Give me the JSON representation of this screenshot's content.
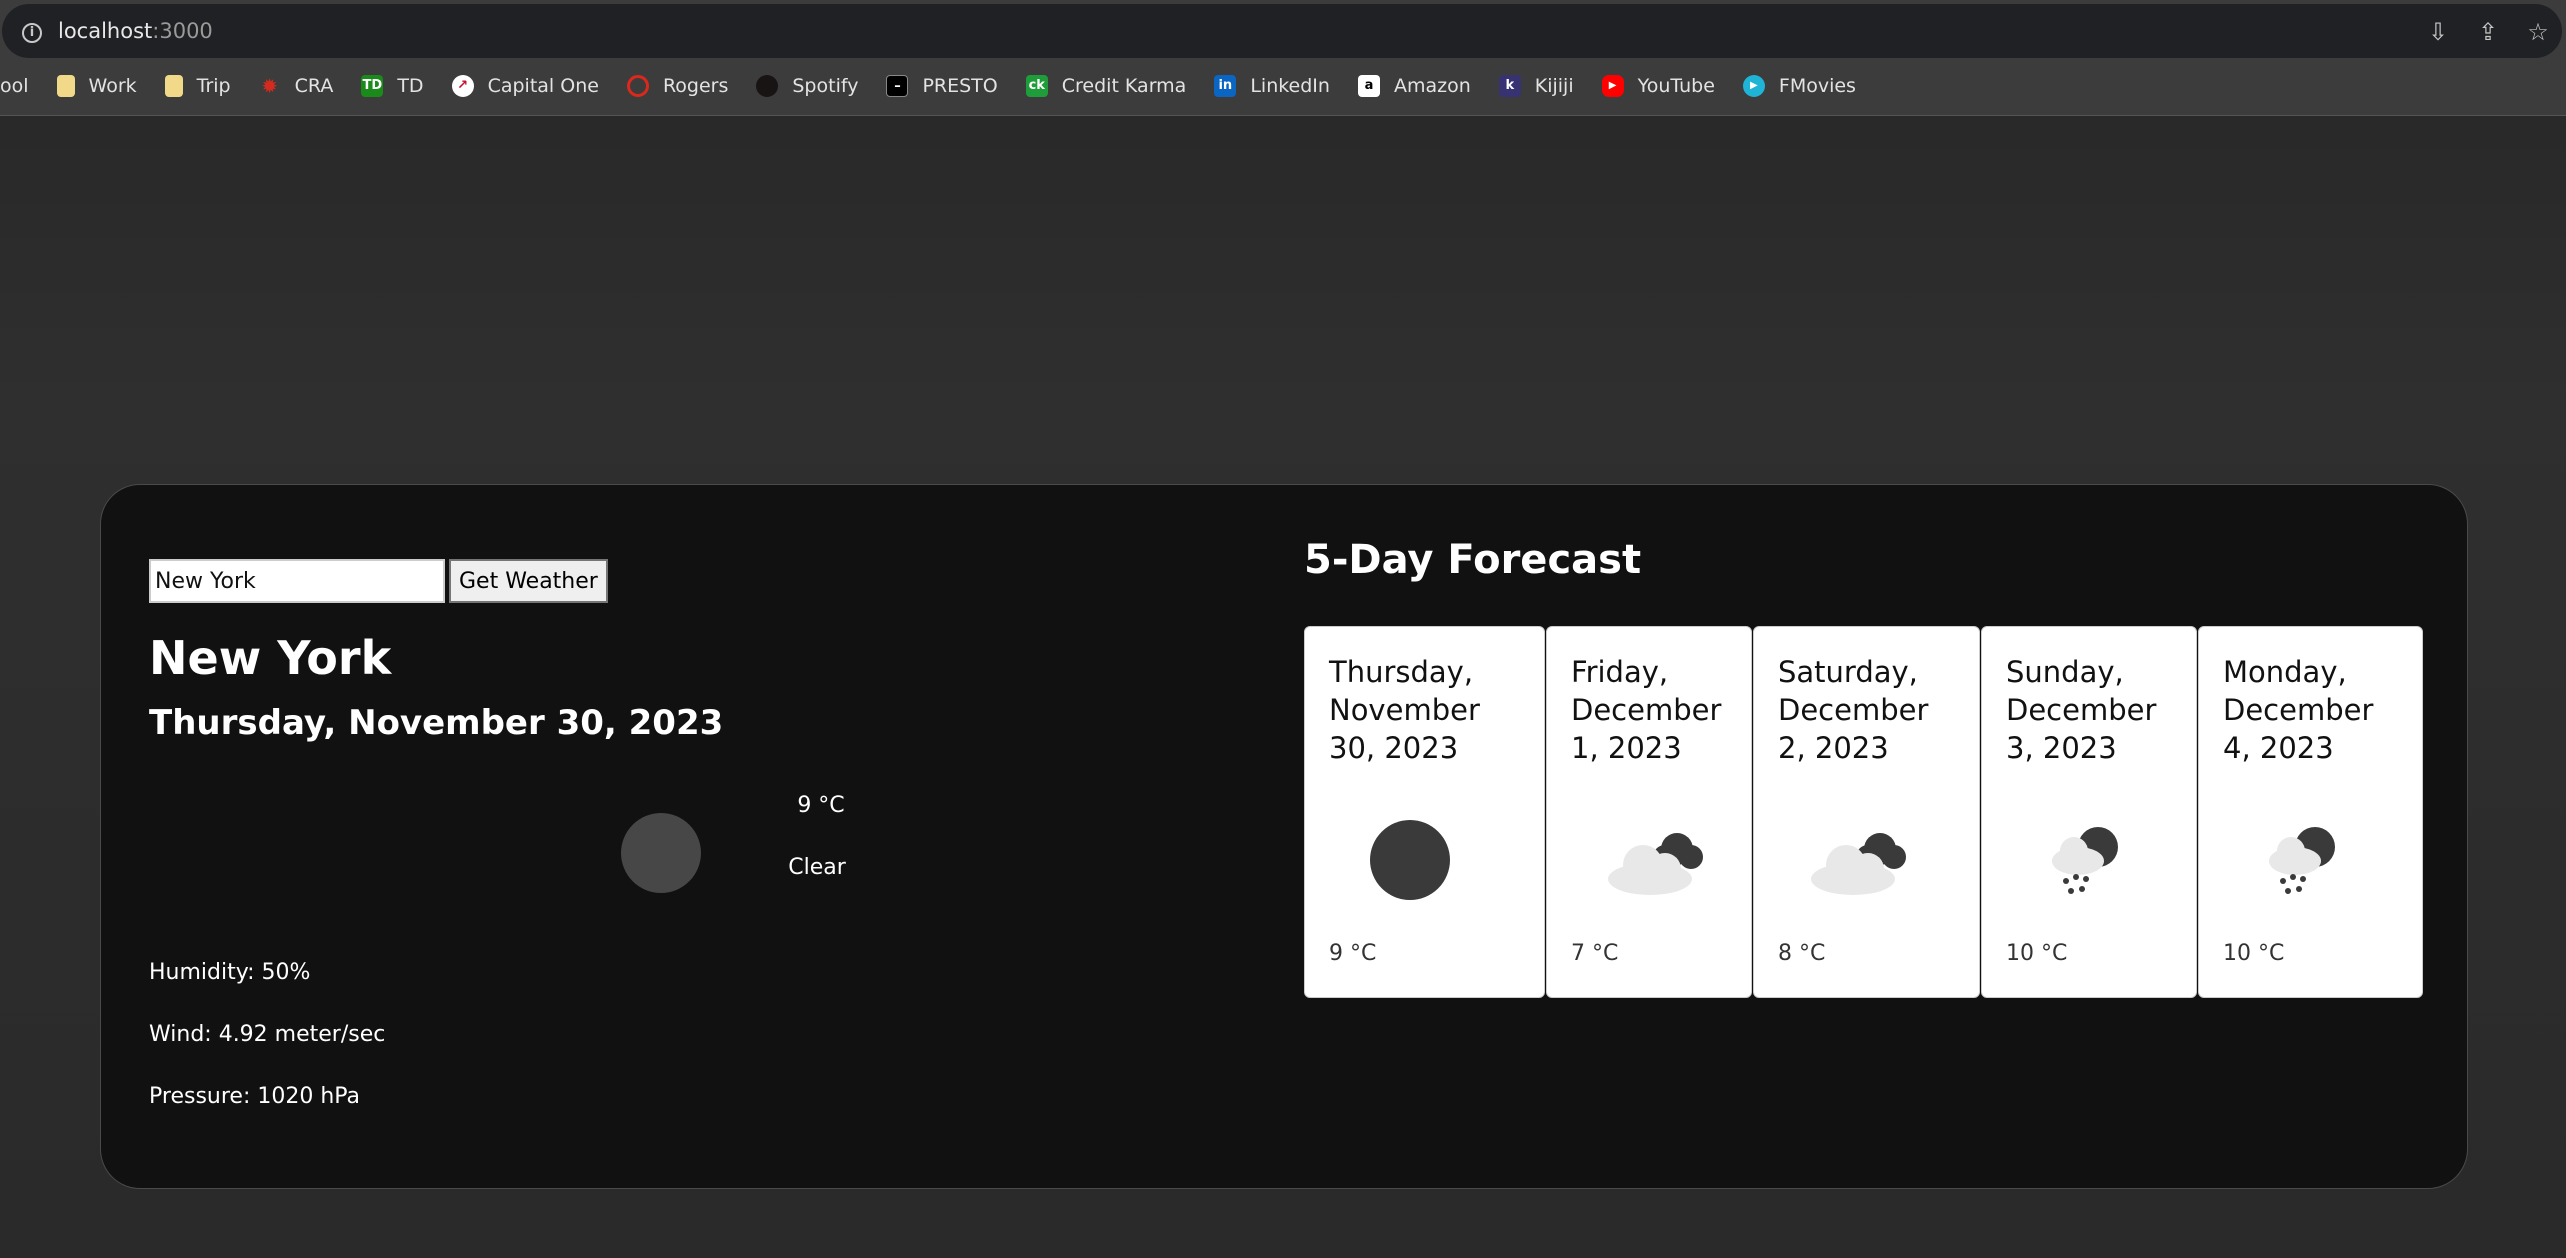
{
  "browser": {
    "url_host": "localhost",
    "url_port": ":3000",
    "bookmarks": [
      {
        "label": "ool",
        "icon": "folder-icon"
      },
      {
        "label": "Work",
        "icon": "folder-icon"
      },
      {
        "label": "Trip",
        "icon": "folder-icon"
      },
      {
        "label": "CRA",
        "icon": "maple-leaf-icon"
      },
      {
        "label": "TD",
        "icon": "td-logo-icon"
      },
      {
        "label": "Capital One",
        "icon": "capital-one-icon"
      },
      {
        "label": "Rogers",
        "icon": "rogers-icon"
      },
      {
        "label": "Spotify",
        "icon": "spotify-icon"
      },
      {
        "label": "PRESTO",
        "icon": "presto-icon"
      },
      {
        "label": "Credit Karma",
        "icon": "credit-karma-icon"
      },
      {
        "label": "LinkedIn",
        "icon": "linkedin-icon"
      },
      {
        "label": "Amazon",
        "icon": "amazon-icon"
      },
      {
        "label": "Kijiji",
        "icon": "kijiji-icon"
      },
      {
        "label": "YouTube",
        "icon": "youtube-icon"
      },
      {
        "label": "FMovies",
        "icon": "fmovies-icon"
      }
    ]
  },
  "search": {
    "value": "New York",
    "button_label": "Get Weather"
  },
  "current": {
    "city": "New York",
    "date": "Thursday, November 30, 2023",
    "temp": "9 °C",
    "description": "Clear",
    "icon": "clear-sky-icon",
    "humidity": "Humidity: 50%",
    "wind": "Wind: 4.92 meter/sec",
    "pressure": "Pressure: 1020 hPa"
  },
  "forecast": {
    "title": "5-Day Forecast",
    "days": [
      {
        "line1": "Thursday,",
        "line2": "November",
        "line3": "30, 2023",
        "temp": "9 °C",
        "icon": "clear-sky-icon"
      },
      {
        "line1": "Friday,",
        "line2": "December",
        "line3": "1, 2023",
        "temp": "7 °C",
        "icon": "cloudy-night-icon"
      },
      {
        "line1": "Saturday,",
        "line2": "December",
        "line3": "2, 2023",
        "temp": "8 °C",
        "icon": "cloudy-night-icon"
      },
      {
        "line1": "Sunday,",
        "line2": "December",
        "line3": "3, 2023",
        "temp": "10 °C",
        "icon": "rain-night-icon"
      },
      {
        "line1": "Monday,",
        "line2": "December",
        "line3": "4, 2023",
        "temp": "10 °C",
        "icon": "rain-night-icon"
      }
    ]
  },
  "colors": {
    "card_background": "#111111",
    "forecast_card": "#ffffff",
    "page_background": "#2b2b2b"
  }
}
